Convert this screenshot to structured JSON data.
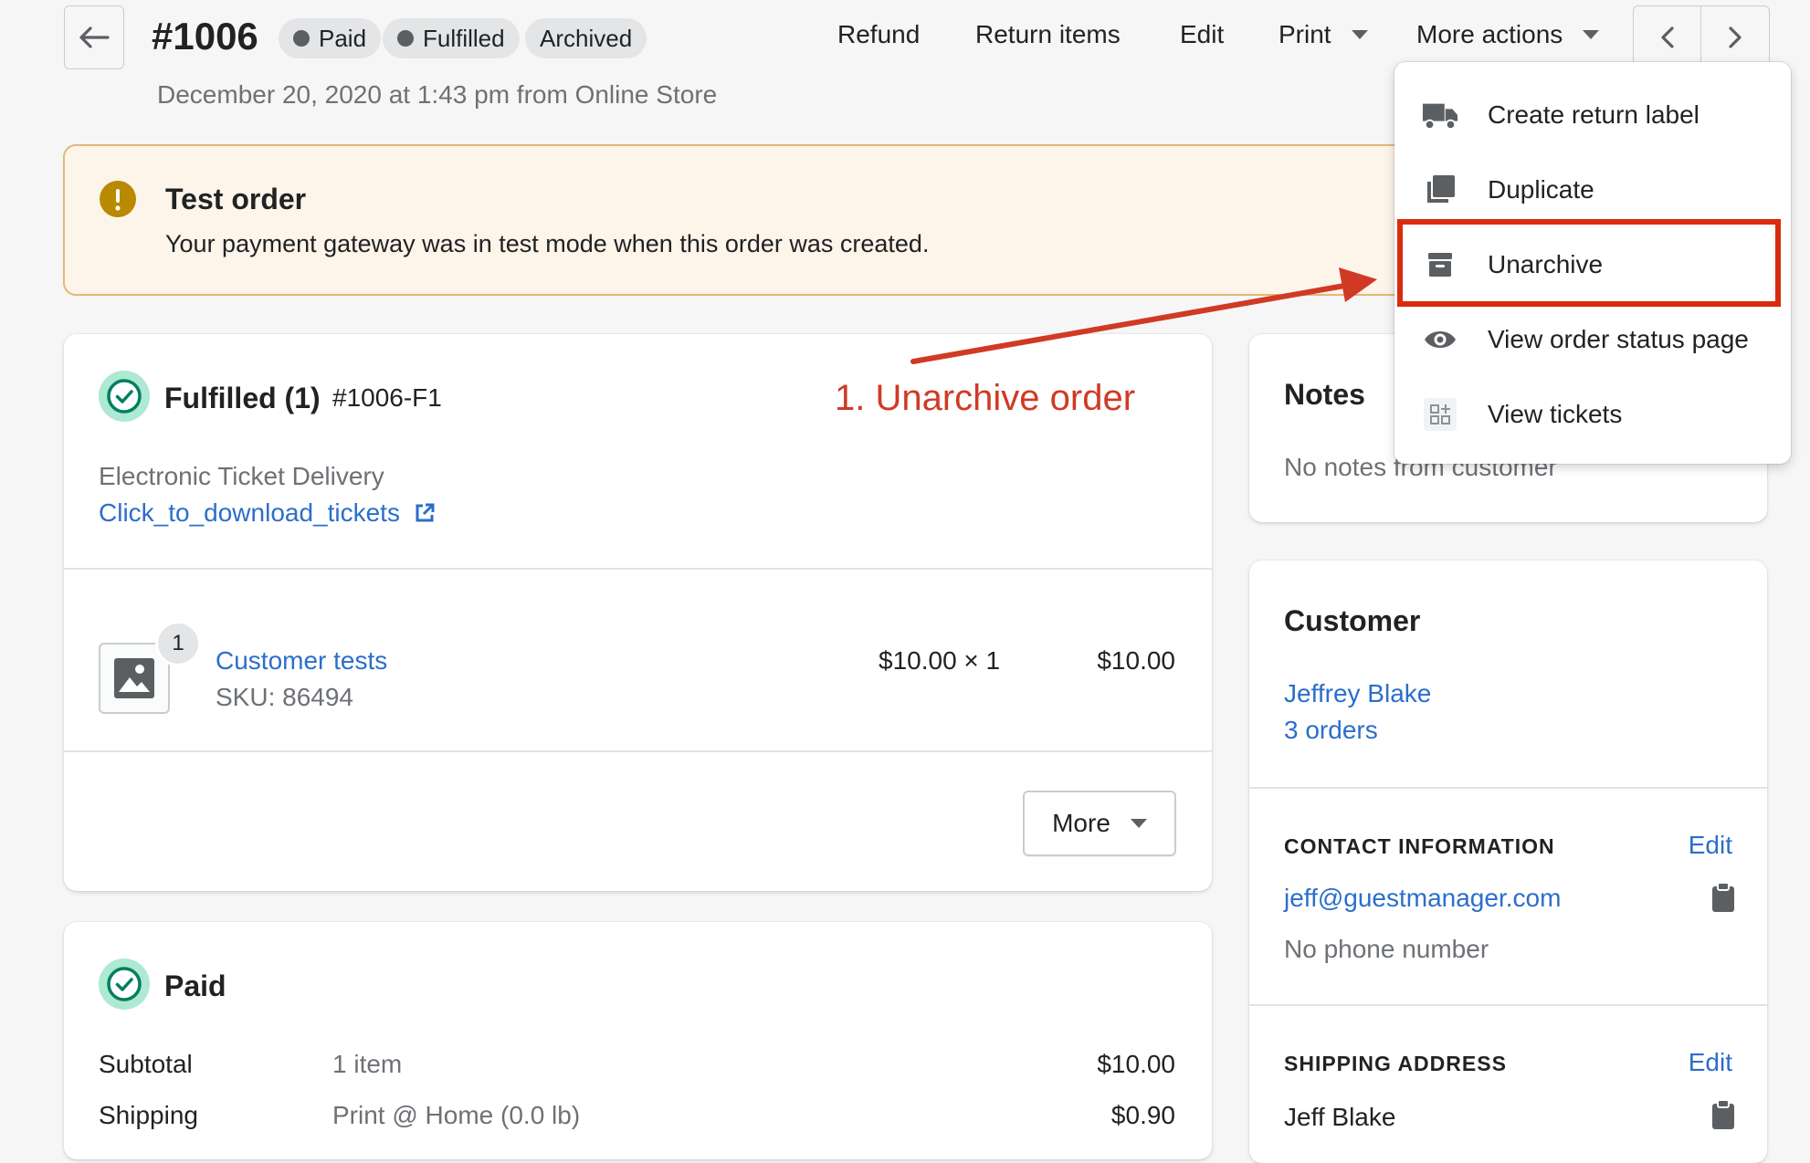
{
  "header": {
    "order_number": "#1006",
    "badges": [
      {
        "label": "Paid",
        "dot": true
      },
      {
        "label": "Fulfilled",
        "dot": true
      },
      {
        "label": "Archived",
        "dot": false
      }
    ],
    "subtitle": "December 20, 2020 at 1:43 pm from Online Store",
    "actions": {
      "refund": "Refund",
      "return_items": "Return items",
      "edit": "Edit",
      "print": "Print",
      "more_actions": "More actions"
    }
  },
  "banner": {
    "title": "Test order",
    "message": "Your payment gateway was in test mode when this order was created.",
    "icon": "alert-circle-icon"
  },
  "dropdown": {
    "items": [
      {
        "label": "Create return label",
        "icon": "truck-icon"
      },
      {
        "label": "Duplicate",
        "icon": "duplicate-icon"
      },
      {
        "label": "Unarchive",
        "icon": "archive-box-icon"
      },
      {
        "label": "View order status page",
        "icon": "eye-icon"
      },
      {
        "label": "View tickets",
        "icon": "app-grid-icon"
      }
    ],
    "highlight_color": "#d72c0d"
  },
  "annotation": {
    "text": "1. Unarchive order",
    "color": "#d03a24"
  },
  "fulfilled_card": {
    "title": "Fulfilled (1)",
    "fulfillment_id": "#1006-F1",
    "delivery_label": "Electronic Ticket Delivery",
    "download_link": "Click_to_download_tickets",
    "line_item": {
      "quantity_badge": "1",
      "product_name": "Customer tests",
      "sku": "SKU: 86494",
      "price_qty": "$10.00 × 1",
      "total": "$10.00"
    },
    "more_button": "More"
  },
  "paid_card": {
    "title": "Paid",
    "rows": [
      {
        "label": "Subtotal",
        "detail": "1 item",
        "amount": "$10.00"
      },
      {
        "label": "Shipping",
        "detail": "Print @ Home (0.0 lb)",
        "amount": "$0.90"
      }
    ]
  },
  "notes_card": {
    "title": "Notes",
    "text": "No notes from customer"
  },
  "customer_card": {
    "title": "Customer",
    "name": "Jeffrey Blake",
    "orders": "3 orders",
    "contact_heading": "CONTACT INFORMATION",
    "contact_edit": "Edit",
    "email": "jeff@guestmanager.com",
    "phone": "No phone number",
    "shipping_heading": "SHIPPING ADDRESS",
    "shipping_edit": "Edit",
    "shipping_name": "Jeff Blake"
  }
}
